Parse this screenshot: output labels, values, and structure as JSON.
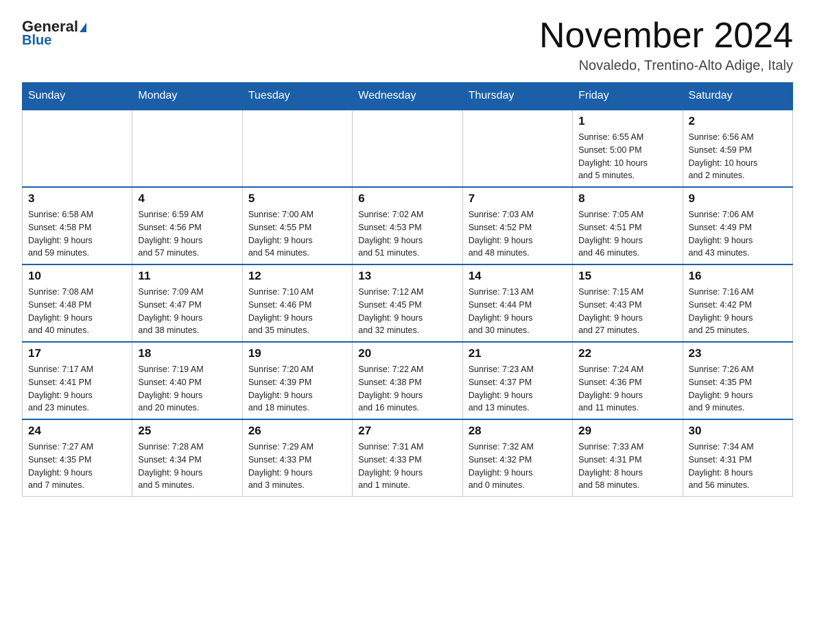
{
  "header": {
    "logo_general": "General",
    "logo_blue": "Blue",
    "month_title": "November 2024",
    "location": "Novaledo, Trentino-Alto Adige, Italy"
  },
  "weekdays": [
    "Sunday",
    "Monday",
    "Tuesday",
    "Wednesday",
    "Thursday",
    "Friday",
    "Saturday"
  ],
  "weeks": [
    [
      {
        "day": "",
        "info": ""
      },
      {
        "day": "",
        "info": ""
      },
      {
        "day": "",
        "info": ""
      },
      {
        "day": "",
        "info": ""
      },
      {
        "day": "",
        "info": ""
      },
      {
        "day": "1",
        "info": "Sunrise: 6:55 AM\nSunset: 5:00 PM\nDaylight: 10 hours\nand 5 minutes."
      },
      {
        "day": "2",
        "info": "Sunrise: 6:56 AM\nSunset: 4:59 PM\nDaylight: 10 hours\nand 2 minutes."
      }
    ],
    [
      {
        "day": "3",
        "info": "Sunrise: 6:58 AM\nSunset: 4:58 PM\nDaylight: 9 hours\nand 59 minutes."
      },
      {
        "day": "4",
        "info": "Sunrise: 6:59 AM\nSunset: 4:56 PM\nDaylight: 9 hours\nand 57 minutes."
      },
      {
        "day": "5",
        "info": "Sunrise: 7:00 AM\nSunset: 4:55 PM\nDaylight: 9 hours\nand 54 minutes."
      },
      {
        "day": "6",
        "info": "Sunrise: 7:02 AM\nSunset: 4:53 PM\nDaylight: 9 hours\nand 51 minutes."
      },
      {
        "day": "7",
        "info": "Sunrise: 7:03 AM\nSunset: 4:52 PM\nDaylight: 9 hours\nand 48 minutes."
      },
      {
        "day": "8",
        "info": "Sunrise: 7:05 AM\nSunset: 4:51 PM\nDaylight: 9 hours\nand 46 minutes."
      },
      {
        "day": "9",
        "info": "Sunrise: 7:06 AM\nSunset: 4:49 PM\nDaylight: 9 hours\nand 43 minutes."
      }
    ],
    [
      {
        "day": "10",
        "info": "Sunrise: 7:08 AM\nSunset: 4:48 PM\nDaylight: 9 hours\nand 40 minutes."
      },
      {
        "day": "11",
        "info": "Sunrise: 7:09 AM\nSunset: 4:47 PM\nDaylight: 9 hours\nand 38 minutes."
      },
      {
        "day": "12",
        "info": "Sunrise: 7:10 AM\nSunset: 4:46 PM\nDaylight: 9 hours\nand 35 minutes."
      },
      {
        "day": "13",
        "info": "Sunrise: 7:12 AM\nSunset: 4:45 PM\nDaylight: 9 hours\nand 32 minutes."
      },
      {
        "day": "14",
        "info": "Sunrise: 7:13 AM\nSunset: 4:44 PM\nDaylight: 9 hours\nand 30 minutes."
      },
      {
        "day": "15",
        "info": "Sunrise: 7:15 AM\nSunset: 4:43 PM\nDaylight: 9 hours\nand 27 minutes."
      },
      {
        "day": "16",
        "info": "Sunrise: 7:16 AM\nSunset: 4:42 PM\nDaylight: 9 hours\nand 25 minutes."
      }
    ],
    [
      {
        "day": "17",
        "info": "Sunrise: 7:17 AM\nSunset: 4:41 PM\nDaylight: 9 hours\nand 23 minutes."
      },
      {
        "day": "18",
        "info": "Sunrise: 7:19 AM\nSunset: 4:40 PM\nDaylight: 9 hours\nand 20 minutes."
      },
      {
        "day": "19",
        "info": "Sunrise: 7:20 AM\nSunset: 4:39 PM\nDaylight: 9 hours\nand 18 minutes."
      },
      {
        "day": "20",
        "info": "Sunrise: 7:22 AM\nSunset: 4:38 PM\nDaylight: 9 hours\nand 16 minutes."
      },
      {
        "day": "21",
        "info": "Sunrise: 7:23 AM\nSunset: 4:37 PM\nDaylight: 9 hours\nand 13 minutes."
      },
      {
        "day": "22",
        "info": "Sunrise: 7:24 AM\nSunset: 4:36 PM\nDaylight: 9 hours\nand 11 minutes."
      },
      {
        "day": "23",
        "info": "Sunrise: 7:26 AM\nSunset: 4:35 PM\nDaylight: 9 hours\nand 9 minutes."
      }
    ],
    [
      {
        "day": "24",
        "info": "Sunrise: 7:27 AM\nSunset: 4:35 PM\nDaylight: 9 hours\nand 7 minutes."
      },
      {
        "day": "25",
        "info": "Sunrise: 7:28 AM\nSunset: 4:34 PM\nDaylight: 9 hours\nand 5 minutes."
      },
      {
        "day": "26",
        "info": "Sunrise: 7:29 AM\nSunset: 4:33 PM\nDaylight: 9 hours\nand 3 minutes."
      },
      {
        "day": "27",
        "info": "Sunrise: 7:31 AM\nSunset: 4:33 PM\nDaylight: 9 hours\nand 1 minute."
      },
      {
        "day": "28",
        "info": "Sunrise: 7:32 AM\nSunset: 4:32 PM\nDaylight: 9 hours\nand 0 minutes."
      },
      {
        "day": "29",
        "info": "Sunrise: 7:33 AM\nSunset: 4:31 PM\nDaylight: 8 hours\nand 58 minutes."
      },
      {
        "day": "30",
        "info": "Sunrise: 7:34 AM\nSunset: 4:31 PM\nDaylight: 8 hours\nand 56 minutes."
      }
    ]
  ]
}
